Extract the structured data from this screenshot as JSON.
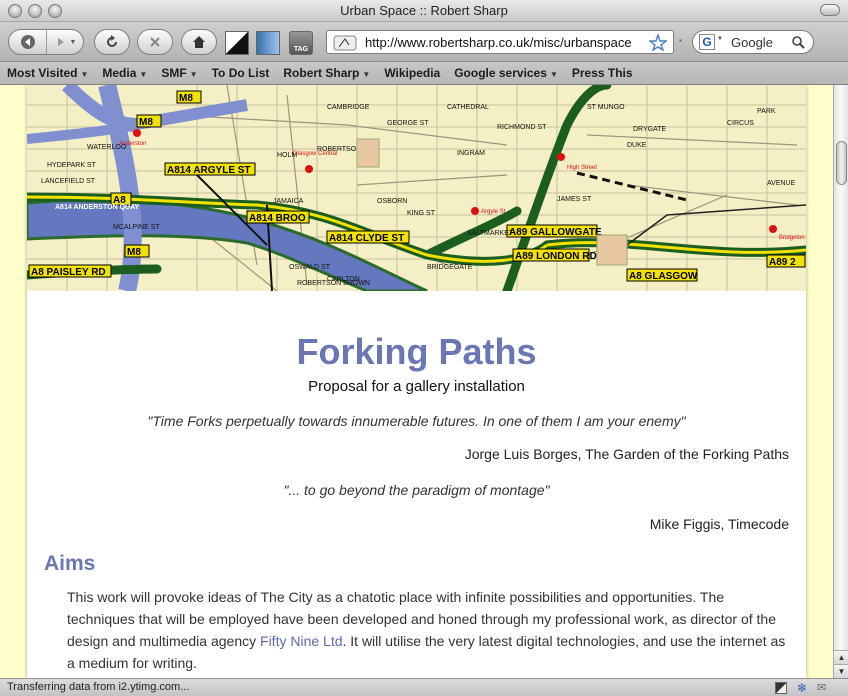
{
  "window": {
    "title": "Urban Space :: Robert Sharp"
  },
  "toolbar": {
    "url": "http://www.robertsharp.co.uk/misc/urbanspace",
    "search_placeholder": "Google",
    "tag_label": "TAG"
  },
  "bookmarks": [
    {
      "label": "Most Visited",
      "menu": true
    },
    {
      "label": "Media",
      "menu": true
    },
    {
      "label": "SMF",
      "menu": true
    },
    {
      "label": "To Do List",
      "menu": false
    },
    {
      "label": "Robert Sharp",
      "menu": true
    },
    {
      "label": "Wikipedia",
      "menu": false
    },
    {
      "label": "Google services",
      "menu": true
    },
    {
      "label": "Press This",
      "menu": false
    }
  ],
  "map": {
    "roads": [
      "M8",
      "M8",
      "M8",
      "A814 ARGYLE ST",
      "A8",
      "A814 ANDERSTON QUAY",
      "A814 BROO",
      "A8 PAISLEY RD",
      "A814 CLYDE ST",
      "A89 GALLOWGATE",
      "A89 LONDON RD",
      "A8 GLASGOW",
      "A89 2",
      "LANCEFIELD ST",
      "HYDEPARK ST",
      "MCALPINE ST",
      "JAMAICA",
      "OSWALD ST",
      "ROBERTSON",
      "ROBERTSON BROWN",
      "WATERLOO",
      "CAMBRIDGE"
    ],
    "places": [
      "Anderston",
      "Glasgow Central",
      "Argyle St",
      "High Street",
      "Bridgeton"
    ],
    "streets": [
      "DUKE",
      "INGRAM",
      "GEORGE ST",
      "CATHEDRAL",
      "RICHMOND ST",
      "DRYGATE",
      "CIRCUS",
      "PARK",
      "AVENUE",
      "OSBORN",
      "KING ST",
      "CARLTON",
      "HOLM",
      "BRIDGEGATE",
      "JAMES ST",
      "ST MUNGO",
      "SALTMARKET"
    ]
  },
  "article": {
    "title": "Forking Paths",
    "subtitle": "Proposal for a gallery installation",
    "quote1": "\"Time Forks perpetually towards innumerable futures. In one of them I am your enemy\"",
    "cite1": "Jorge Luis Borges, The Garden of the Forking Paths",
    "quote2": "\"... to go beyond the paradigm of montage\"",
    "cite2": "Mike Figgis, Timecode",
    "section_heading": "Aims",
    "para_before_link": "This work will provoke ideas of The City as a chatotic place with infinite possibilities and opportunities. The techniques that will be employed have been developed and honed through my professional work, as director of the design and multimedia agency ",
    "link_text": "Fifty Nine Ltd",
    "para_after_link": ". It will utilise the very latest digital technologies, and use the internet as a medium for writing."
  },
  "status": {
    "text": "Transferring data from i2.ytimg.com..."
  },
  "colors": {
    "heading": "#6b77b4",
    "margin_bg": "#ffffcc",
    "link": "#5a69b0"
  }
}
